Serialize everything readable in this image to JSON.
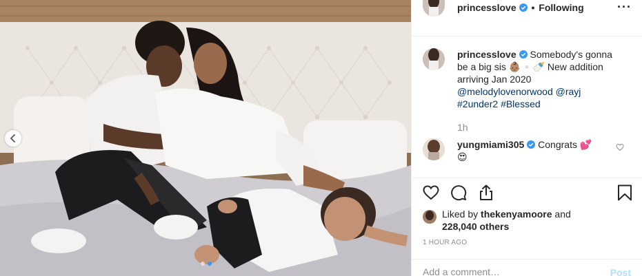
{
  "header": {
    "username": "princesslove",
    "separator": "•",
    "follow_label": "Following",
    "more_icon": "more-horizontal-icon",
    "more_label": "···"
  },
  "caption": {
    "username": "princesslove",
    "text": "Somebody's gonna be a big sis",
    "emoji": "👶🏽▫️🍼",
    "text_after": "New addition arriving Jan 2020",
    "mentions": [
      "@melodylovenorwood",
      "@rayj"
    ],
    "hashtags": [
      "#2under2",
      "#Blessed"
    ],
    "time": "1h"
  },
  "comments": [
    {
      "username": "yungmiami305",
      "text": "Congrats",
      "emoji_inline": "💕",
      "emoji_line2": "😍"
    }
  ],
  "actions": {
    "like_icon": "heart-outline-icon",
    "comment_icon": "comment-bubble-icon",
    "share_icon": "share-upload-icon",
    "save_icon": "bookmark-icon"
  },
  "likes": {
    "prefix": "Liked by",
    "user": "thekenyamoore",
    "middle": "and",
    "count": "228,040 others"
  },
  "post_time": "1 HOUR AGO",
  "add_comment": {
    "placeholder": "Add a comment…",
    "post_label": "Post"
  },
  "carousel": {
    "total_slides": 2,
    "active_slide": 2
  },
  "colors": {
    "verified": "#3897f0",
    "mention": "#003569",
    "muted": "#8e8e8e",
    "post_disabled": "#b2dffc",
    "active_dot": "#3897f0"
  }
}
